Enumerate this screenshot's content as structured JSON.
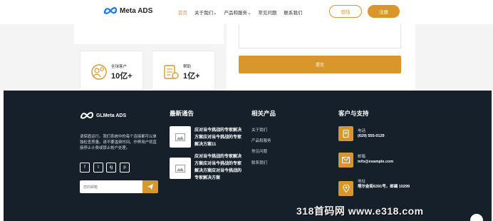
{
  "header": {
    "brand": "Meta ADS",
    "nav": [
      {
        "label": "首页",
        "active": true
      },
      {
        "label": "关于我们⌄",
        "active": false
      },
      {
        "label": "产品和服务⌄",
        "active": false
      },
      {
        "label": "常见问题",
        "active": false
      },
      {
        "label": "联系我们",
        "active": false
      }
    ],
    "login_label": "登陆",
    "register_label": "注册",
    "accent_color": "#d9962b"
  },
  "stats": [
    {
      "label": "全球客户",
      "value": "10亿+",
      "icon": "global-customers-icon"
    },
    {
      "label": "帮助",
      "value": "1亿+",
      "icon": "help-documents-icon"
    }
  ],
  "form": {
    "submit_label": "提交"
  },
  "footer": {
    "brand": "GLMeta ADS",
    "description": "请保盾运行。我们系统中的每个连接都可以单独检查质量。请不要滥费时间。作弊用户将直接停止计费或禁止帐户处理。",
    "social": [
      "f",
      "t",
      "ig",
      "p"
    ],
    "newsletter_placeholder": "您的邮箱",
    "news_title": "最新通告",
    "news": [
      "应对当今挑战的专家解决方案应对当今挑战的专家解决方案11",
      "应对当今挑战的专家解决方案应对当今挑战的专家解决方案应对当今挑战的专家解决方案"
    ],
    "related_title": "相关产品",
    "related_links": [
      "关于我们",
      "产品和服务",
      "常见问题",
      "联系我们"
    ],
    "support_title": "客户与支持",
    "contacts": [
      {
        "label": "电话",
        "value": "(629) 555-0129",
        "icon": "phone-icon"
      },
      {
        "label": "邮箱",
        "value": "info@example.com",
        "icon": "mail-icon"
      },
      {
        "label": "地址",
        "value": "塔尔金街6391号，邮编 10299",
        "icon": "location-icon"
      }
    ]
  },
  "watermark": "318首码网 www.e318.com"
}
